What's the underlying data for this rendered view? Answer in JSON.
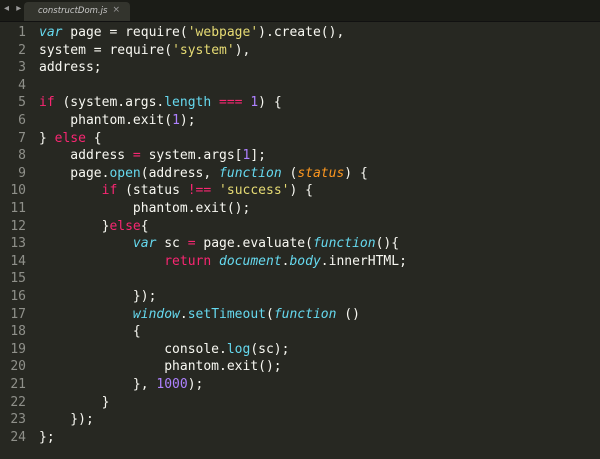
{
  "window": {
    "nav_arrows": "◂ ▸",
    "tab": {
      "label": "constructDom.js",
      "close": "×"
    }
  },
  "colors": {
    "background": "#272822",
    "keyword": "#f92672",
    "storage": "#66d9ef",
    "string": "#e6db74",
    "number": "#ae81ff",
    "param": "#fd971f",
    "text": "#f8f8f2",
    "gutter": "#8f908a"
  },
  "editor": {
    "lines": [
      {
        "num": "1",
        "tokens": [
          [
            "storage",
            "var"
          ],
          [
            "plain",
            " page = require("
          ],
          [
            "string",
            "'webpage'"
          ],
          [
            "plain",
            ").create(),"
          ]
        ]
      },
      {
        "num": "2",
        "tokens": [
          [
            "plain",
            "system = require("
          ],
          [
            "string",
            "'system'"
          ],
          [
            "plain",
            "),"
          ]
        ]
      },
      {
        "num": "3",
        "tokens": [
          [
            "plain",
            "address;"
          ]
        ]
      },
      {
        "num": "4",
        "tokens": []
      },
      {
        "num": "5",
        "tokens": [
          [
            "keyword",
            "if"
          ],
          [
            "plain",
            " (system.args."
          ],
          [
            "support",
            "length"
          ],
          [
            "plain",
            " "
          ],
          [
            "keyword",
            "==="
          ],
          [
            "plain",
            " "
          ],
          [
            "number",
            "1"
          ],
          [
            "plain",
            ") {"
          ]
        ]
      },
      {
        "num": "6",
        "tokens": [
          [
            "plain",
            "    phantom.exit("
          ],
          [
            "number",
            "1"
          ],
          [
            "plain",
            ");"
          ]
        ]
      },
      {
        "num": "7",
        "tokens": [
          [
            "plain",
            "} "
          ],
          [
            "keyword",
            "else"
          ],
          [
            "plain",
            " {"
          ]
        ]
      },
      {
        "num": "8",
        "tokens": [
          [
            "plain",
            "    address "
          ],
          [
            "keyword",
            "="
          ],
          [
            "plain",
            " system.args["
          ],
          [
            "number",
            "1"
          ],
          [
            "plain",
            "];"
          ]
        ]
      },
      {
        "num": "9",
        "tokens": [
          [
            "plain",
            "    page."
          ],
          [
            "support",
            "open"
          ],
          [
            "plain",
            "(address, "
          ],
          [
            "storage",
            "function"
          ],
          [
            "plain",
            " ("
          ],
          [
            "param",
            "status"
          ],
          [
            "plain",
            ") {"
          ]
        ]
      },
      {
        "num": "10",
        "tokens": [
          [
            "plain",
            "        "
          ],
          [
            "keyword",
            "if"
          ],
          [
            "plain",
            " (status "
          ],
          [
            "keyword",
            "!=="
          ],
          [
            "plain",
            " "
          ],
          [
            "string",
            "'success'"
          ],
          [
            "plain",
            ") {"
          ]
        ]
      },
      {
        "num": "11",
        "tokens": [
          [
            "plain",
            "            phantom.exit();"
          ]
        ]
      },
      {
        "num": "12",
        "tokens": [
          [
            "plain",
            "        }"
          ],
          [
            "keyword",
            "else"
          ],
          [
            "plain",
            "{"
          ]
        ]
      },
      {
        "num": "13",
        "tokens": [
          [
            "plain",
            "            "
          ],
          [
            "storage",
            "var"
          ],
          [
            "plain",
            " sc "
          ],
          [
            "keyword",
            "="
          ],
          [
            "plain",
            " page.evaluate("
          ],
          [
            "storage",
            "function"
          ],
          [
            "plain",
            "(){"
          ]
        ]
      },
      {
        "num": "14",
        "tokens": [
          [
            "plain",
            "                "
          ],
          [
            "keyword",
            "return"
          ],
          [
            "plain",
            " "
          ],
          [
            "storage",
            "document"
          ],
          [
            "plain",
            "."
          ],
          [
            "storage",
            "body"
          ],
          [
            "plain",
            ".innerHTML;"
          ]
        ]
      },
      {
        "num": "15",
        "tokens": []
      },
      {
        "num": "16",
        "tokens": [
          [
            "plain",
            "            });"
          ]
        ]
      },
      {
        "num": "17",
        "tokens": [
          [
            "plain",
            "            "
          ],
          [
            "storage",
            "window"
          ],
          [
            "plain",
            "."
          ],
          [
            "support",
            "setTimeout"
          ],
          [
            "plain",
            "("
          ],
          [
            "storage",
            "function"
          ],
          [
            "plain",
            " ()"
          ]
        ]
      },
      {
        "num": "18",
        "tokens": [
          [
            "plain",
            "            {"
          ]
        ]
      },
      {
        "num": "19",
        "tokens": [
          [
            "plain",
            "                console."
          ],
          [
            "support",
            "log"
          ],
          [
            "plain",
            "(sc);"
          ]
        ]
      },
      {
        "num": "20",
        "tokens": [
          [
            "plain",
            "                phantom.exit();"
          ]
        ]
      },
      {
        "num": "21",
        "tokens": [
          [
            "plain",
            "            }, "
          ],
          [
            "number",
            "1000"
          ],
          [
            "plain",
            ");"
          ]
        ]
      },
      {
        "num": "22",
        "tokens": [
          [
            "plain",
            "        }"
          ]
        ]
      },
      {
        "num": "23",
        "tokens": [
          [
            "plain",
            "    });"
          ]
        ]
      },
      {
        "num": "24",
        "tokens": [
          [
            "plain",
            "};"
          ]
        ]
      }
    ]
  }
}
